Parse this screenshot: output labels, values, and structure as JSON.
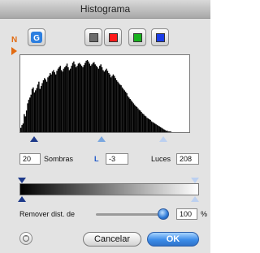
{
  "window": {
    "title": "Histograma"
  },
  "markers": {
    "n_label": "N"
  },
  "toolbar": {
    "channel_buttons": [
      {
        "name": "gray",
        "color": "#6b6b6b"
      },
      {
        "name": "red",
        "color": "#ff1a1a"
      },
      {
        "name": "green",
        "color": "#19b21f"
      },
      {
        "name": "blue",
        "color": "#1b3de8"
      }
    ],
    "auto_icon": "auto-adjust-icon"
  },
  "histogram": {
    "bins": [
      6,
      10,
      12,
      25,
      22,
      30,
      40,
      45,
      48,
      52,
      60,
      62,
      55,
      58,
      61,
      66,
      70,
      60,
      64,
      68,
      72,
      75,
      73,
      70,
      76,
      78,
      82,
      80,
      84,
      86,
      83,
      80,
      85,
      88,
      90,
      92,
      86,
      84,
      88,
      90,
      92,
      95,
      90,
      86,
      88,
      92,
      96,
      98,
      94,
      90,
      92,
      95,
      96,
      94,
      92,
      90,
      93,
      96,
      99,
      100,
      98,
      95,
      92,
      94,
      96,
      97,
      94,
      92,
      90,
      88,
      92,
      94,
      90,
      86,
      84,
      86,
      88,
      85,
      82,
      80,
      76,
      78,
      80,
      78,
      75,
      72,
      70,
      68,
      66,
      65,
      62,
      60,
      58,
      56,
      54,
      50,
      48,
      46,
      44,
      42,
      40,
      38,
      36,
      35,
      33,
      31,
      30,
      28,
      26,
      25,
      23,
      22,
      20,
      19,
      18,
      17,
      15,
      14,
      13,
      12,
      11,
      10,
      9,
      8,
      7,
      6,
      5,
      4,
      3,
      2,
      2,
      1,
      1,
      1,
      0,
      0,
      0,
      0,
      0,
      0,
      0,
      0,
      0,
      0,
      0,
      0,
      0,
      0,
      0,
      0
    ]
  },
  "levels": {
    "shadows_value": "20",
    "shadows_label": "Sombras",
    "gamma_label": "L",
    "gamma_value": "-3",
    "highlights_label": "Luces",
    "highlights_value": "208"
  },
  "remove": {
    "label": "Remover dist. de",
    "value": "100",
    "unit": "%",
    "slider_fraction": 1.0
  },
  "buttons": {
    "cancel": "Cancelar",
    "ok": "OK",
    "help_icon": "help-icon"
  }
}
